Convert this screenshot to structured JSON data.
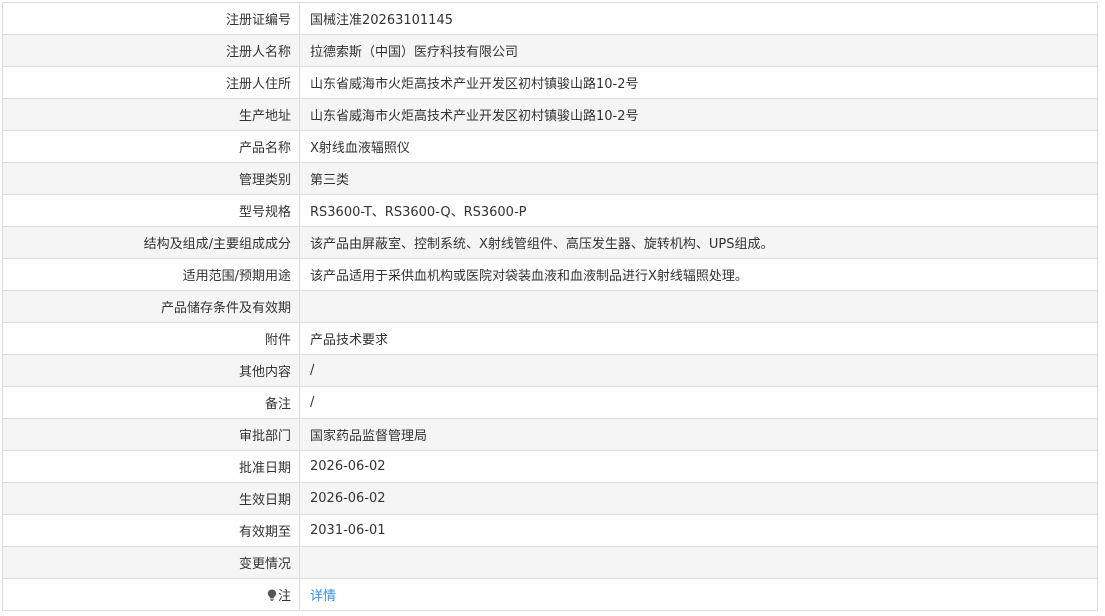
{
  "rows": [
    {
      "label": "注册证编号",
      "value": "国械注准20263101145"
    },
    {
      "label": "注册人名称",
      "value": "拉德索斯（中国）医疗科技有限公司"
    },
    {
      "label": "注册人住所",
      "value": "山东省威海市火炬高技术产业开发区初村镇骏山路10-2号"
    },
    {
      "label": "生产地址",
      "value": "山东省威海市火炬高技术产业开发区初村镇骏山路10-2号"
    },
    {
      "label": "产品名称",
      "value": "X射线血液辐照仪"
    },
    {
      "label": "管理类别",
      "value": "第三类"
    },
    {
      "label": "型号规格",
      "value": "RS3600-T、RS3600-Q、RS3600-P"
    },
    {
      "label": "结构及组成/主要组成成分",
      "value": "该产品由屏蔽室、控制系统、X射线管组件、高压发生器、旋转机构、UPS组成。"
    },
    {
      "label": "适用范围/预期用途",
      "value": "该产品适用于采供血机构或医院对袋装血液和血液制品进行X射线辐照处理。"
    },
    {
      "label": "产品储存条件及有效期",
      "value": ""
    },
    {
      "label": "附件",
      "value": "产品技术要求"
    },
    {
      "label": "其他内容",
      "value": "/"
    },
    {
      "label": "备注",
      "value": "/"
    },
    {
      "label": "审批部门",
      "value": "国家药品监督管理局"
    },
    {
      "label": "批准日期",
      "value": "2026-06-02"
    },
    {
      "label": "生效日期",
      "value": "2026-06-02"
    },
    {
      "label": "有效期至",
      "value": "2031-06-01"
    },
    {
      "label": "变更情况",
      "value": ""
    }
  ],
  "note": {
    "icon": "lightbulb-icon",
    "label": "注",
    "link_text": "详情",
    "link_color": "#3a8ee6"
  }
}
